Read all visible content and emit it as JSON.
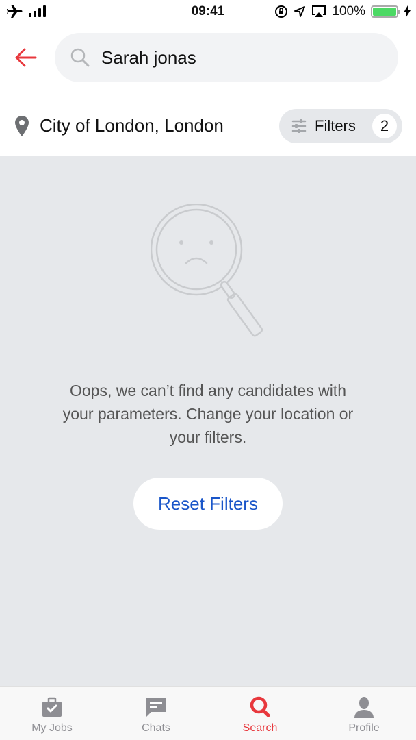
{
  "status_bar": {
    "time": "09:41",
    "battery": "100%",
    "battery_level": 1.0
  },
  "header": {
    "back_icon": "arrow-left-icon",
    "search_value": "Sarah jonas",
    "search_icon": "search-icon"
  },
  "location_bar": {
    "location": "City of London, London",
    "filters_label": "Filters",
    "filters_count": "2"
  },
  "empty_state": {
    "icon": "sad-magnifier-icon",
    "message": "Oops, we can’t find any candidates with your parameters. Change your location or your filters.",
    "reset_label": "Reset Filters"
  },
  "tabs": [
    {
      "label": "My Jobs",
      "icon": "briefcase-check-icon",
      "active": false
    },
    {
      "label": "Chats",
      "icon": "chat-bubble-icon",
      "active": false
    },
    {
      "label": "Search",
      "icon": "search-icon",
      "active": true
    },
    {
      "label": "Profile",
      "icon": "person-icon",
      "active": false
    }
  ],
  "colors": {
    "accent": "#e8383d",
    "link": "#1a56c9",
    "background": "#e6e8eb"
  }
}
